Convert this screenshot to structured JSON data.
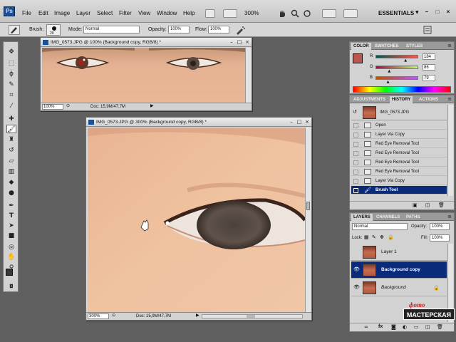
{
  "app": {
    "logo": "Ps",
    "menus": [
      "File",
      "Edit",
      "Image",
      "Layer",
      "Select",
      "Filter",
      "View",
      "Window",
      "Help"
    ],
    "zoom_value": "300%",
    "workspace": "ESSENTIALS",
    "window_controls": [
      "–",
      "□",
      "×"
    ]
  },
  "options_bar": {
    "brush_label": "Brush:",
    "brush_size": "20",
    "mode_label": "Mode:",
    "mode_value": "Normal",
    "opacity_label": "Opacity:",
    "opacity_value": "100%",
    "flow_label": "Flow:",
    "flow_value": "100%"
  },
  "tools": [
    "move-tool",
    "marquee-tool",
    "lasso-tool",
    "quick-select-tool",
    "crop-tool",
    "eyedropper-tool",
    "spot-heal-tool",
    "brush-tool",
    "clone-stamp-tool",
    "history-brush-tool",
    "eraser-tool",
    "gradient-tool",
    "blur-tool",
    "dodge-tool",
    "pen-tool",
    "type-tool",
    "path-select-tool",
    "shape-tool",
    "3d-rotate-tool",
    "hand-tool",
    "zoom-tool"
  ],
  "doc1": {
    "title": "IMG_0573.JPG @ 100% (Background copy, RGB/8) *",
    "zoom": "100%",
    "info": "Doc: 15,9M/47,7M"
  },
  "doc2": {
    "title": "IMG_0573.JPG @ 300% (Background copy, RGB/8) *",
    "zoom": "300%",
    "info": "Doc: 15,9M/47,7M"
  },
  "color_panel": {
    "tabs": [
      "COLOR",
      "SWATCHES",
      "STYLES"
    ],
    "channels": [
      {
        "label": "R",
        "value": "184",
        "level": 0.72
      },
      {
        "label": "G",
        "value": "86",
        "level": 0.34
      },
      {
        "label": "B",
        "value": "79",
        "level": 0.31
      }
    ],
    "foreground": "#b8564f"
  },
  "history_panel": {
    "tabs": [
      "ADJUSTMENTS",
      "HISTORY",
      "ACTIONS"
    ],
    "snapshot": "IMG_0573.JPG",
    "items": [
      "Open",
      "Layer Via Copy",
      "Red Eye Removal Tool",
      "Red Eye Removal Tool",
      "Red Eye Removal Tool",
      "Red Eye Removal Tool",
      "Layer Via Copy",
      "Brush Tool"
    ]
  },
  "layers_panel": {
    "tabs": [
      "LAYERS",
      "CHANNELS",
      "PATHS"
    ],
    "blend_mode": "Normal",
    "opacity_label": "Opacity:",
    "opacity_value": "100%",
    "lock_label": "Lock:",
    "fill_label": "Fill:",
    "fill_value": "100%",
    "layers": [
      {
        "name": "Layer 1"
      },
      {
        "name": "Background copy"
      },
      {
        "name": "Background"
      }
    ]
  },
  "watermark": {
    "line1": "фото",
    "line2": "МАСТЕРСКАЯ"
  },
  "colors": {
    "selection": "#0a2a7a",
    "skin": "#e7b38f",
    "accent": "#1c4f96"
  }
}
